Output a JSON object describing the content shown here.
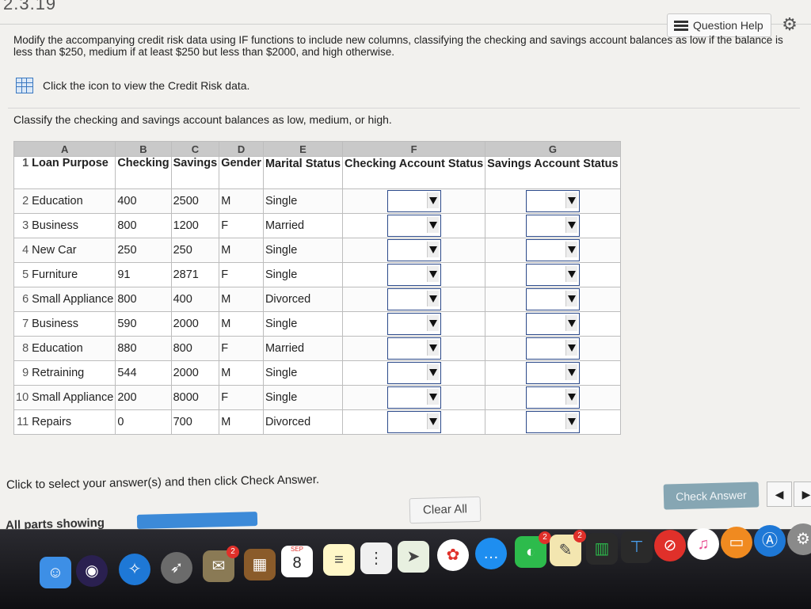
{
  "header": {
    "problem_number": "2.3.19",
    "question_help_label": "Question Help"
  },
  "instructions": "Modify the accompanying credit risk data using IF functions to include new columns, classifying the checking and savings account balances as low if the balance is less than $250, medium if at least $250 but less than $2000, and high otherwise.",
  "data_link_label": "Click the icon to view the Credit Risk data.",
  "classify_prompt": "Classify the checking and savings account balances as low, medium, or high.",
  "sheet": {
    "col_letters": [
      "A",
      "B",
      "C",
      "D",
      "E",
      "F",
      "G"
    ],
    "header_row_num": "1",
    "headers": [
      "Loan Purpose",
      "Checking",
      "Savings",
      "Gender",
      "Marital Status",
      "Checking Account Status",
      "Savings Account Status"
    ],
    "rows": [
      {
        "num": "2",
        "purpose": "Education",
        "checking": "400",
        "savings": "2500",
        "gender": "M",
        "marital": "Single"
      },
      {
        "num": "3",
        "purpose": "Business",
        "checking": "800",
        "savings": "1200",
        "gender": "F",
        "marital": "Married"
      },
      {
        "num": "4",
        "purpose": "New Car",
        "checking": "250",
        "savings": "250",
        "gender": "M",
        "marital": "Single"
      },
      {
        "num": "5",
        "purpose": "Furniture",
        "checking": "91",
        "savings": "2871",
        "gender": "F",
        "marital": "Single"
      },
      {
        "num": "6",
        "purpose": "Small Appliance",
        "checking": "800",
        "savings": "400",
        "gender": "M",
        "marital": "Divorced"
      },
      {
        "num": "7",
        "purpose": "Business",
        "checking": "590",
        "savings": "2000",
        "gender": "M",
        "marital": "Single"
      },
      {
        "num": "8",
        "purpose": "Education",
        "checking": "880",
        "savings": "800",
        "gender": "F",
        "marital": "Married"
      },
      {
        "num": "9",
        "purpose": "Retraining",
        "checking": "544",
        "savings": "2000",
        "gender": "M",
        "marital": "Single"
      },
      {
        "num": "10",
        "purpose": "Small Appliance",
        "checking": "200",
        "savings": "8000",
        "gender": "F",
        "marital": "Single"
      },
      {
        "num": "11",
        "purpose": "Repairs",
        "checking": "0",
        "savings": "700",
        "gender": "M",
        "marital": "Divorced"
      }
    ]
  },
  "footer": {
    "click_note": "Click to select your answer(s) and then click Check Answer.",
    "all_parts": "All parts showing",
    "clear_all": "Clear All",
    "check_answer": "Check Answer"
  },
  "dock": {
    "calendar_month": "SEP",
    "calendar_day": "8",
    "mail_badge": "2",
    "facetime_badge": "2",
    "notes_badge": "2"
  },
  "colors": {
    "progress_bar": "#3c8ad8",
    "check_answer_bg": "#86a6b3",
    "dropdown_border": "#2c4a8a"
  }
}
